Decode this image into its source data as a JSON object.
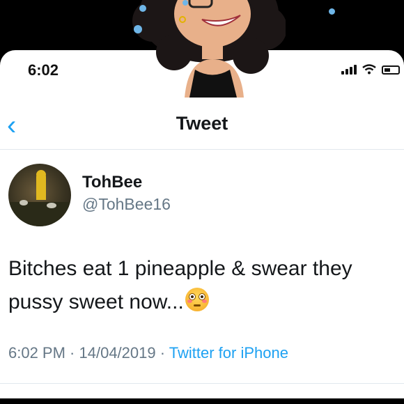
{
  "status_bar": {
    "time": "6:02"
  },
  "nav": {
    "back_icon": "chevron-left-icon",
    "title": "Tweet"
  },
  "author": {
    "display_name": "TohBee",
    "handle": "@TohBee16"
  },
  "tweet": {
    "text": "Bitches eat 1 pineapple & swear they pussy sweet now...",
    "emoji": "flushed-face-icon"
  },
  "meta": {
    "time": "6:02 PM",
    "sep1": " · ",
    "date": "14/04/2019",
    "sep2": " · ",
    "source": "Twitter for iPhone"
  },
  "colors": {
    "link": "#1da1f2",
    "secondary_text": "#657786",
    "primary_text": "#14171a"
  }
}
